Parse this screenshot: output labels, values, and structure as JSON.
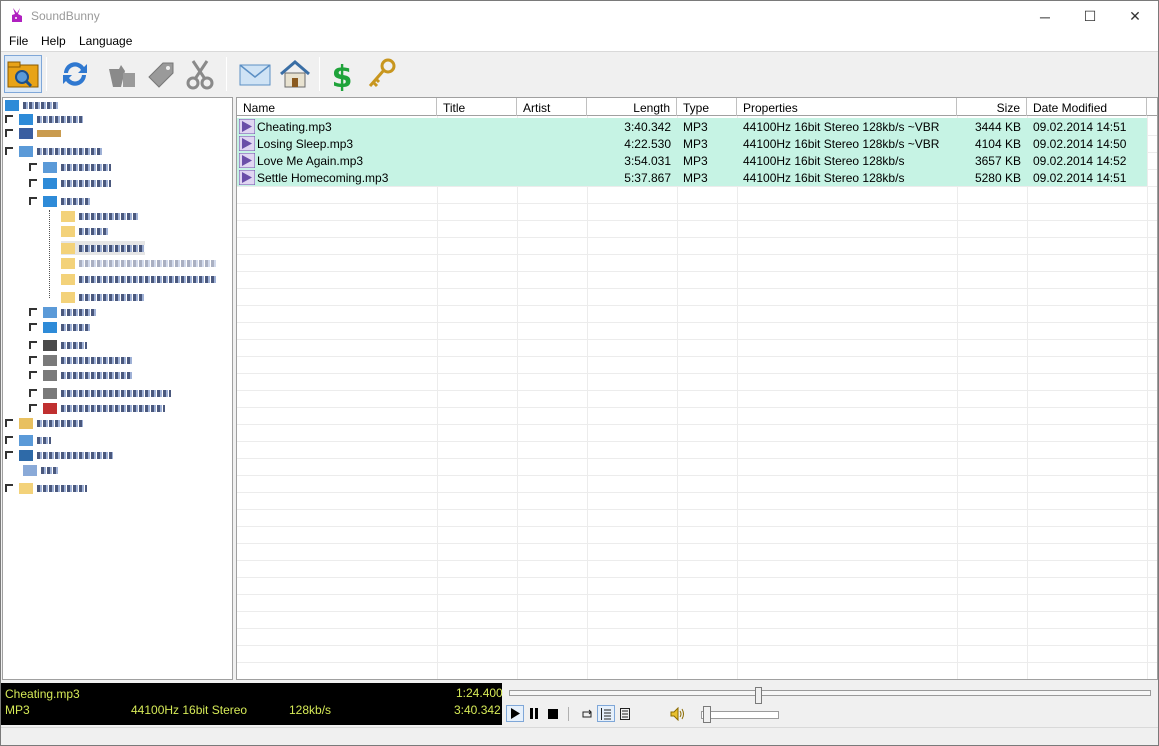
{
  "window": {
    "title": "SoundBunny",
    "controls": {
      "minimize": "─",
      "maximize": "☐",
      "close": "✕"
    }
  },
  "menu": [
    "File",
    "Help",
    "Language"
  ],
  "toolbar": {
    "buttons": [
      "open-folder-icon",
      "refresh-icon",
      "tag-from-filename-icon",
      "tag-icon",
      "cut-icon",
      "email-icon",
      "home-icon",
      "buy-icon",
      "register-key-icon"
    ]
  },
  "filelist": {
    "columns": [
      "Name",
      "Title",
      "Artist",
      "Length",
      "Type",
      "Properties",
      "Size",
      "Date Modified"
    ],
    "rows": [
      {
        "name": "Cheating.mp3",
        "title": "",
        "artist": "",
        "length": "3:40.342",
        "type": "MP3",
        "properties": "44100Hz 16bit Stereo 128kb/s ~VBR",
        "size": "3444 KB",
        "modified": "09.02.2014 14:51"
      },
      {
        "name": "Losing Sleep.mp3",
        "title": "",
        "artist": "",
        "length": "4:22.530",
        "type": "MP3",
        "properties": "44100Hz 16bit Stereo 128kb/s ~VBR",
        "size": "4104 KB",
        "modified": "09.02.2014 14:50"
      },
      {
        "name": "Love Me Again.mp3",
        "title": "",
        "artist": "",
        "length": "3:54.031",
        "type": "MP3",
        "properties": "44100Hz 16bit Stereo 128kb/s",
        "size": "3657 KB",
        "modified": "09.02.2014 14:52"
      },
      {
        "name": "Settle Homecoming.mp3",
        "title": "",
        "artist": "",
        "length": "5:37.867",
        "type": "MP3",
        "properties": "44100Hz 16bit Stereo 128kb/s",
        "size": "5280 KB",
        "modified": "09.02.2014 14:51"
      }
    ]
  },
  "player": {
    "file": "Cheating.mp3",
    "type": "MP3",
    "format": "44100Hz 16bit Stereo",
    "bitrate": "128kb/s",
    "position": "1:24.400",
    "duration": "3:40.342",
    "seek_fraction": 0.383,
    "volume_fraction": 0.05
  },
  "colors": {
    "selected_row": "#c6f3e4",
    "player_bg": "#000000",
    "player_text": "#d6ea57"
  }
}
